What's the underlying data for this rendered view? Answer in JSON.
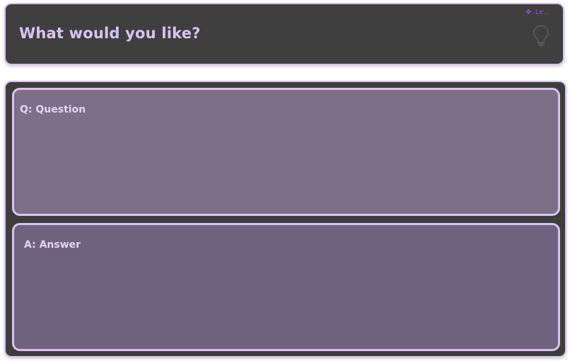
{
  "header": {
    "title": "What would you like?",
    "badge": {
      "icon": "diamond-icon",
      "text": "Le..."
    },
    "hint_icon": "lightbulb-icon"
  },
  "qa_panel": {
    "question_label": "Q: Question",
    "answer_label": "A: Answer"
  },
  "colors": {
    "accent": "#dcc2f5",
    "border": "#d9c2f0",
    "header_bg": "#3f3f3f",
    "panel_bg": "#3d3d3d",
    "question_bg": "#7e6e87",
    "answer_bg": "#6d6380",
    "badge": "#8f56c8"
  }
}
